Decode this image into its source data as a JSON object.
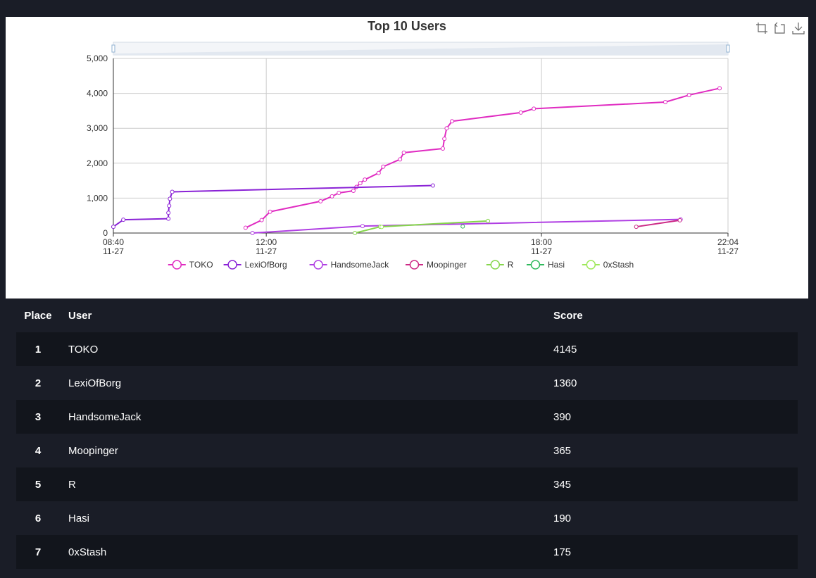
{
  "chart_data": {
    "type": "line",
    "title": "Top 10 Users",
    "x_ticks": [
      {
        "time": "08:40",
        "date": "11-27",
        "t": 520
      },
      {
        "time": "12:00",
        "date": "11-27",
        "t": 720
      },
      {
        "time": "18:00",
        "date": "11-27",
        "t": 1080
      },
      {
        "time": "22:04",
        "date": "11-27",
        "t": 1324
      }
    ],
    "xlim_minutes_of_day": [
      520,
      1324
    ],
    "ylim": [
      0,
      5000
    ],
    "y_ticks": [
      "0",
      "1,000",
      "2,000",
      "3,000",
      "4,000",
      "5,000"
    ],
    "grid": true,
    "legend_position": "bottom",
    "series": [
      {
        "name": "TOKO",
        "color": "#e02bc1",
        "points": [
          [
            693,
            150
          ],
          [
            714,
            370
          ],
          [
            725,
            610
          ],
          [
            791,
            910
          ],
          [
            806,
            1050
          ],
          [
            815,
            1150
          ],
          [
            834,
            1210
          ],
          [
            838,
            1320
          ],
          [
            843,
            1430
          ],
          [
            849,
            1530
          ],
          [
            867,
            1720
          ],
          [
            873,
            1900
          ],
          [
            895,
            2110
          ],
          [
            900,
            2300
          ],
          [
            951,
            2420
          ],
          [
            953,
            2700
          ],
          [
            956,
            3000
          ],
          [
            963,
            3200
          ],
          [
            1053,
            3450
          ],
          [
            1070,
            3560
          ],
          [
            1242,
            3750
          ],
          [
            1273,
            3950
          ],
          [
            1313,
            4145
          ]
        ]
      },
      {
        "name": "LexiOfBorg",
        "color": "#8a22d6",
        "points": [
          [
            520,
            180
          ],
          [
            533,
            380
          ],
          [
            592,
            410
          ],
          [
            592,
            580
          ],
          [
            593,
            780
          ],
          [
            594,
            980
          ],
          [
            597,
            1180
          ],
          [
            938,
            1360
          ]
        ]
      },
      {
        "name": "HandsomeJack",
        "color": "#b03fe3",
        "points": [
          [
            702,
            0
          ],
          [
            846,
            200
          ],
          [
            1262,
            390
          ]
        ]
      },
      {
        "name": "Moopinger",
        "color": "#cc2a86",
        "points": [
          [
            1204,
            180
          ],
          [
            1261,
            365
          ]
        ]
      },
      {
        "name": "R",
        "color": "#86d64c",
        "points": [
          [
            836,
            0
          ],
          [
            869,
            180
          ],
          [
            1010,
            345
          ]
        ]
      },
      {
        "name": "Hasi",
        "color": "#2fb95c",
        "points": [
          [
            977,
            190
          ]
        ]
      },
      {
        "name": "0xStash",
        "color": "#9ee85a",
        "points": [
          [
            871,
            175
          ]
        ]
      }
    ]
  },
  "table": {
    "headers": {
      "place": "Place",
      "user": "User",
      "score": "Score"
    },
    "rows": [
      {
        "place": "1",
        "user": "TOKO",
        "score": "4145"
      },
      {
        "place": "2",
        "user": "LexiOfBorg",
        "score": "1360"
      },
      {
        "place": "3",
        "user": "HandsomeJack",
        "score": "390"
      },
      {
        "place": "4",
        "user": "Moopinger",
        "score": "365"
      },
      {
        "place": "5",
        "user": "R",
        "score": "345"
      },
      {
        "place": "6",
        "user": "Hasi",
        "score": "190"
      },
      {
        "place": "7",
        "user": "0xStash",
        "score": "175"
      }
    ]
  },
  "toolbar": {
    "icons": [
      "zoom-icon",
      "restore-icon",
      "download-icon"
    ]
  }
}
